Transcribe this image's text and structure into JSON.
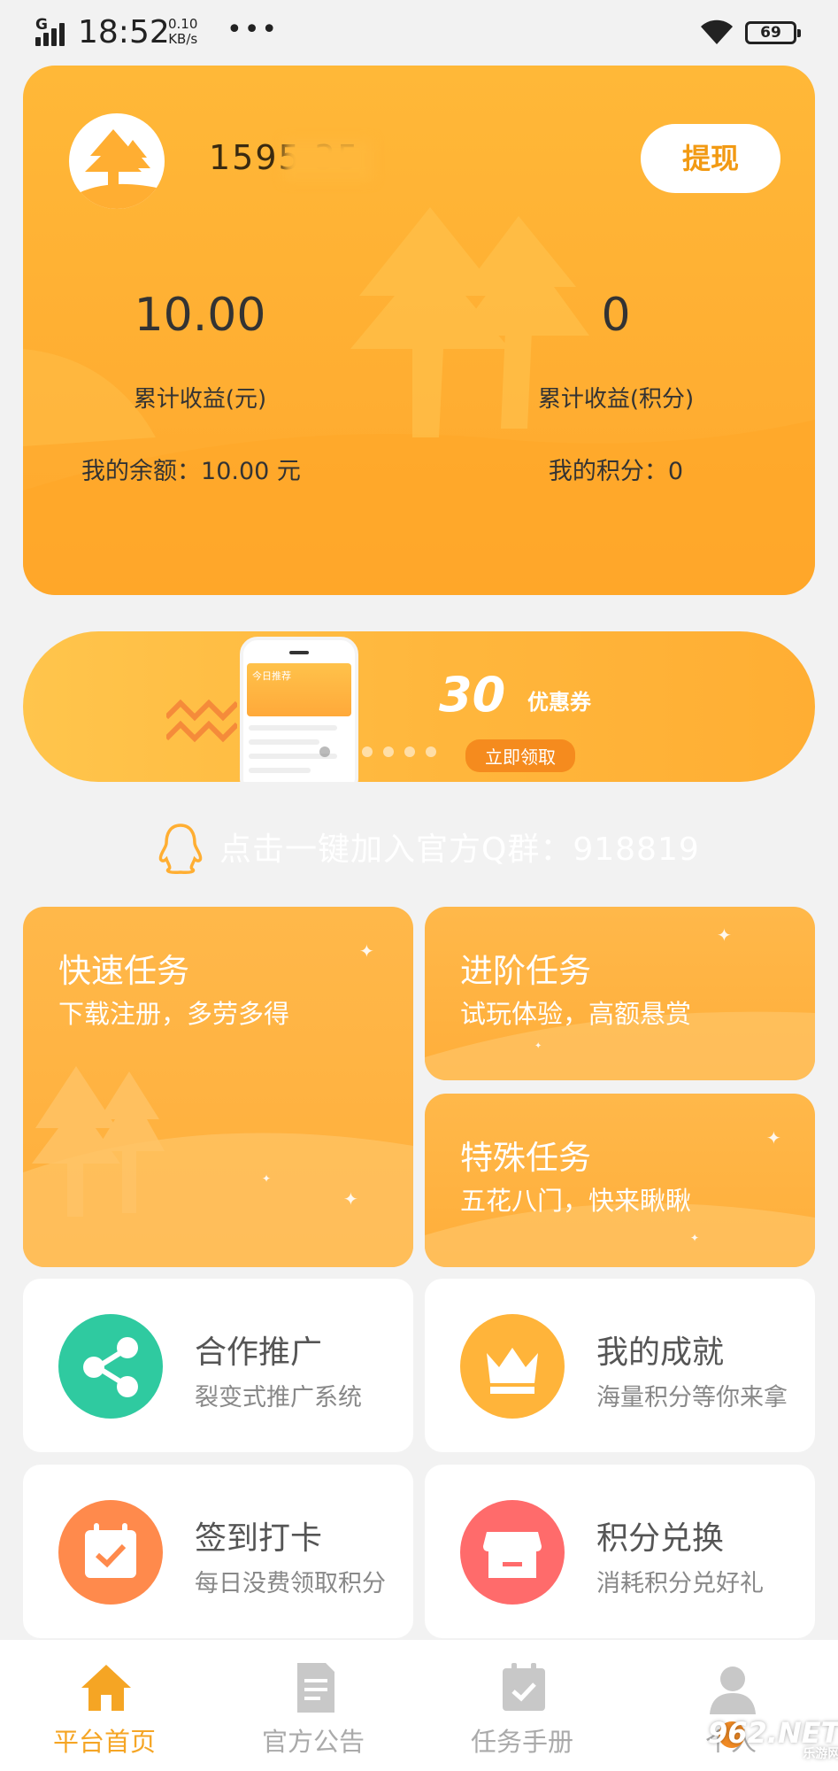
{
  "status_bar": {
    "network": "G",
    "time": "18:52",
    "speed_value": "0.10",
    "speed_unit": "KB/s",
    "more": "•••",
    "battery": "69"
  },
  "account": {
    "phone": "1595 35",
    "withdraw_label": "提现",
    "total_yuan_value": "10.00",
    "total_yuan_label": "累计收益(元)",
    "total_points_value": "0",
    "total_points_label": "累计收益(积分)",
    "balance_text": "我的余额：10.00 元",
    "points_text": "我的积分：0"
  },
  "banner": {
    "phone_screen_title": "今日推荐",
    "big_text": "30",
    "coupon_text": "优惠券",
    "button_text": "立即领取",
    "slide_count": 6,
    "active_slide": 0
  },
  "qq_group": {
    "text": "点击一键加入官方Q群：918819"
  },
  "tasks": [
    {
      "title": "快速任务",
      "subtitle": "下载注册，多劳多得"
    },
    {
      "title": "进阶任务",
      "subtitle": "试玩体验，高额悬赏"
    },
    {
      "title": "特殊任务",
      "subtitle": "五花八门，快来瞅瞅"
    }
  ],
  "features": [
    {
      "title": "合作推广",
      "subtitle": "裂变式推广系统",
      "icon": "share-icon",
      "color": "#2fcaa0"
    },
    {
      "title": "我的成就",
      "subtitle": "海量积分等你来拿",
      "icon": "crown-icon",
      "color": "#ffb43a"
    },
    {
      "title": "签到打卡",
      "subtitle": "每日没费领取积分",
      "icon": "calendar-check-icon",
      "color": "#ff8a4c"
    },
    {
      "title": "积分兑换",
      "subtitle": "消耗积分兑好礼",
      "icon": "shop-icon",
      "color": "#ff6b6b"
    }
  ],
  "nav": [
    {
      "label": "平台首页",
      "icon": "home-icon",
      "active": true
    },
    {
      "label": "官方公告",
      "icon": "notice-icon",
      "active": false
    },
    {
      "label": "任务手册",
      "icon": "task-manual-icon",
      "active": false
    },
    {
      "label": "个人",
      "icon": "user-icon",
      "active": false
    }
  ],
  "watermark": {
    "text": "962.NET",
    "sub": "乐游网"
  },
  "colors": {
    "accent": "#ffb038",
    "nav_active": "#f5a524",
    "nav_inactive": "#aaaaaa"
  }
}
